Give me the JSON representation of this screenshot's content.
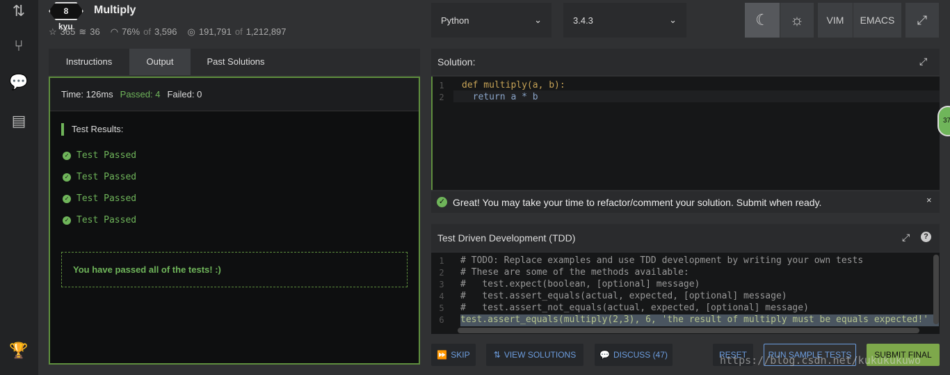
{
  "kata": {
    "rank": "8",
    "rank_unit": "kyu",
    "title": "Multiply",
    "stars": "365",
    "collections": "36",
    "satisfaction": "76%",
    "of": "of",
    "votes": "3,596",
    "completed": "191,791",
    "attempts": "1,212,897"
  },
  "toolbar": {
    "language": "Python",
    "version": "3.4.3",
    "vim": "VIM",
    "emacs": "EMACS"
  },
  "tabs": [
    "Instructions",
    "Output",
    "Past Solutions"
  ],
  "output": {
    "time": "Time: 126ms",
    "passed": "Passed: 4",
    "failed": "Failed: 0",
    "results_heading": "Test Results:",
    "results": [
      "Test Passed",
      "Test Passed",
      "Test Passed",
      "Test Passed"
    ],
    "summary": "You have passed all of the tests! :)"
  },
  "solution": {
    "title": "Solution:",
    "lines": [
      "def multiply(a, b):",
      "  return a * b"
    ],
    "message": "Great! You may take your time to refactor/comment your solution. Submit when ready.",
    "badge": "37"
  },
  "tdd": {
    "title": "Test Driven Development (TDD)",
    "lines": [
      "# TODO: Replace examples and use TDD development by writing your own tests",
      "# These are some of the methods available:",
      "#   test.expect(boolean, [optional] message)",
      "#   test.assert_equals(actual, expected, [optional] message)",
      "#   test.assert_not_equals(actual, expected, [optional] message)",
      "test.assert_equals(multiply(2,3), 6, 'the result of multiply must be equals expected!'"
    ]
  },
  "actions": {
    "skip": "SKIP",
    "view_solutions": "VIEW SOLUTIONS",
    "discuss": "DISCUSS (47)",
    "reset": "RESET",
    "run_sample": "RUN SAMPLE TESTS",
    "submit": "SUBMIT FINAL"
  },
  "watermark": "https://blog.csdn.net/kukukukuwo",
  "colors": {
    "green": "#6fb55a",
    "blue": "#6d9ee0",
    "submit": "#7ea84b"
  }
}
